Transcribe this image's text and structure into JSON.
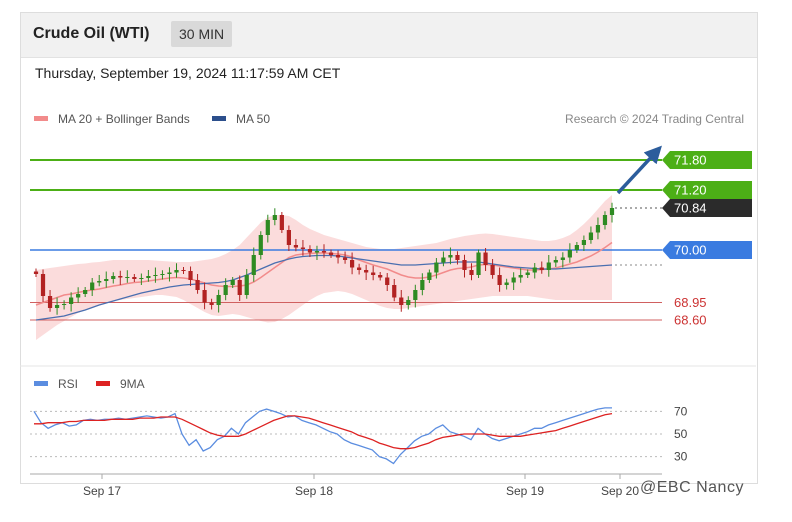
{
  "header": {
    "title": "Crude Oil (WTI)",
    "interval": "30 MIN"
  },
  "timestamp": "Thursday, September 19, 2024 11:17:59 AM CET",
  "credit": "Research © 2024 Trading Central",
  "watermark": "@EBC Nancy",
  "colors": {
    "bull": "#2e8b22",
    "bear": "#b22222",
    "ma20": "#f28b8b",
    "bands": "#f9c9c9",
    "ma50": "#4a6fb0",
    "resistance": "#4caf16",
    "pivot": "#3a7be0",
    "support": "#d06060",
    "rsi": "#5b8de0",
    "rsi_ma": "#dd2222",
    "arrow": "#2c5d9c"
  },
  "chart_data": [
    {
      "type": "candlestick",
      "title": "Crude Oil (WTI) 30 MIN",
      "legend": [
        "MA 20 + Bollinger Bands",
        "MA 50"
      ],
      "legend_position": "top-left",
      "x_ticks": [
        "Sep 17",
        "Sep 18",
        "Sep 19",
        "Sep 20"
      ],
      "ylim": [
        68.0,
        72.2
      ],
      "levels": [
        {
          "label": "71.80",
          "value": 71.8,
          "kind": "resistance"
        },
        {
          "label": "71.20",
          "value": 71.2,
          "kind": "resistance"
        },
        {
          "label": "70.84",
          "value": 70.84,
          "kind": "last"
        },
        {
          "label": "70.00",
          "value": 70.0,
          "kind": "pivot"
        },
        {
          "label": "68.95",
          "value": 68.95,
          "kind": "support"
        },
        {
          "label": "68.60",
          "value": 68.6,
          "kind": "support"
        }
      ],
      "close": [
        69.52,
        69.08,
        68.84,
        68.9,
        68.92,
        69.05,
        69.12,
        69.2,
        69.35,
        69.38,
        69.42,
        69.48,
        69.45,
        69.46,
        69.42,
        69.44,
        69.48,
        69.5,
        69.52,
        69.55,
        69.6,
        69.58,
        69.4,
        69.2,
        68.95,
        68.9,
        69.1,
        69.3,
        69.4,
        69.1,
        69.5,
        69.9,
        70.3,
        70.6,
        70.7,
        70.4,
        70.1,
        70.05,
        70.02,
        69.95,
        69.98,
        69.95,
        69.9,
        69.85,
        69.8,
        69.65,
        69.6,
        69.55,
        69.5,
        69.45,
        69.3,
        69.05,
        68.9,
        69.0,
        69.2,
        69.4,
        69.55,
        69.75,
        69.85,
        69.9,
        69.8,
        69.6,
        69.5,
        69.95,
        69.7,
        69.5,
        69.3,
        69.35,
        69.45,
        69.5,
        69.55,
        69.65,
        69.6,
        69.75,
        69.8,
        69.85,
        70.0,
        70.1,
        70.2,
        70.35,
        70.5,
        70.7,
        70.84
      ],
      "ma20": [
        68.9,
        68.95,
        69.0,
        69.05,
        69.1,
        69.12,
        69.15,
        69.18,
        69.2,
        69.22,
        69.25,
        69.28,
        69.3,
        69.33,
        69.35,
        69.36,
        69.38,
        69.4,
        69.42,
        69.44,
        69.45,
        69.44,
        69.42,
        69.38,
        69.34,
        69.3,
        69.28,
        69.27,
        69.27,
        69.28,
        69.3,
        69.36,
        69.45,
        69.55,
        69.65,
        69.75,
        69.85,
        69.9,
        69.92,
        69.93,
        69.94,
        69.94,
        69.93,
        69.92,
        69.9,
        69.86,
        69.8,
        69.75,
        69.7,
        69.66,
        69.62,
        69.56,
        69.5,
        69.46,
        69.44,
        69.44,
        69.46,
        69.5,
        69.55,
        69.6,
        69.63,
        69.64,
        69.66,
        69.7,
        69.71,
        69.7,
        69.68,
        69.66,
        69.64,
        69.62,
        69.6,
        69.6,
        69.61,
        69.62,
        69.64,
        69.68,
        69.72,
        69.76,
        69.82,
        69.88,
        69.96,
        70.05,
        70.15
      ],
      "bb_upper": [
        69.6,
        69.62,
        69.64,
        69.66,
        69.68,
        69.7,
        69.72,
        69.73,
        69.75,
        69.76,
        69.78,
        69.8,
        69.8,
        69.8,
        69.8,
        69.8,
        69.8,
        69.79,
        69.78,
        69.77,
        69.76,
        69.76,
        69.76,
        69.78,
        69.8,
        69.82,
        69.86,
        69.92,
        70.0,
        70.1,
        70.25,
        70.4,
        70.55,
        70.65,
        70.7,
        70.7,
        70.68,
        70.6,
        70.5,
        70.42,
        70.36,
        70.3,
        70.26,
        70.22,
        70.18,
        70.14,
        70.1,
        70.06,
        70.04,
        70.02,
        70.02,
        70.02,
        70.04,
        70.06,
        70.08,
        70.1,
        70.12,
        70.14,
        70.18,
        70.22,
        70.25,
        70.28,
        70.3,
        70.32,
        70.33,
        70.32,
        70.3,
        70.28,
        70.26,
        70.24,
        70.22,
        70.2,
        70.18,
        70.18,
        70.2,
        70.24,
        70.3,
        70.4,
        70.52,
        70.66,
        70.82,
        70.98,
        71.1
      ],
      "bb_lower": [
        68.2,
        68.3,
        68.4,
        68.5,
        68.58,
        68.66,
        68.74,
        68.8,
        68.86,
        68.9,
        68.94,
        68.98,
        69.0,
        69.02,
        69.04,
        69.06,
        69.08,
        69.1,
        69.1,
        69.08,
        69.06,
        69.0,
        68.92,
        68.84,
        68.76,
        68.7,
        68.68,
        68.7,
        68.72,
        68.7,
        68.66,
        68.62,
        68.58,
        68.55,
        68.56,
        68.62,
        68.7,
        68.8,
        68.9,
        69.0,
        69.08,
        69.14,
        69.16,
        69.18,
        69.16,
        69.12,
        69.06,
        69.0,
        68.94,
        68.88,
        68.84,
        68.82,
        68.82,
        68.84,
        68.86,
        68.88,
        68.9,
        68.92,
        68.94,
        68.96,
        68.98,
        69.0,
        69.02,
        69.04,
        69.06,
        69.08,
        69.08,
        69.08,
        69.08,
        69.08,
        69.08,
        69.06,
        69.04,
        69.02,
        69.0,
        69.0,
        69.0,
        69.0,
        69.0,
        69.0,
        69.0,
        69.0,
        69.0
      ],
      "ma50": [
        68.6,
        68.62,
        68.64,
        68.66,
        68.68,
        68.72,
        68.76,
        68.8,
        68.85,
        68.9,
        68.94,
        68.98,
        69.02,
        69.06,
        69.1,
        69.14,
        69.17,
        69.2,
        69.23,
        69.26,
        69.28,
        69.3,
        69.31,
        69.32,
        69.33,
        69.34,
        69.35,
        69.37,
        69.4,
        69.45,
        69.5,
        69.56,
        69.62,
        69.68,
        69.74,
        69.78,
        69.82,
        69.85,
        69.87,
        69.88,
        69.89,
        69.89,
        69.89,
        69.88,
        69.86,
        69.84,
        69.82,
        69.8,
        69.78,
        69.76,
        69.74,
        69.72,
        69.7,
        69.7,
        69.7,
        69.71,
        69.72,
        69.73,
        69.74,
        69.75,
        69.76,
        69.76,
        69.76,
        69.76,
        69.74,
        69.72,
        69.7,
        69.68,
        69.66,
        69.65,
        69.64,
        69.63,
        69.62,
        69.62,
        69.62,
        69.63,
        69.64,
        69.65,
        69.66,
        69.67,
        69.68,
        69.69,
        69.7
      ]
    },
    {
      "type": "line",
      "title": "",
      "legend": [
        "RSI",
        "9MA"
      ],
      "legend_position": "top-left",
      "ylim": [
        20,
        80
      ],
      "y_ticks": [
        "70",
        "50",
        "30"
      ],
      "series": [
        {
          "name": "RSI",
          "values": [
            70,
            60,
            55,
            58,
            60,
            57,
            58,
            62,
            63,
            62,
            63,
            63,
            64,
            63,
            64,
            65,
            66,
            65,
            64,
            65,
            68,
            50,
            40,
            45,
            35,
            38,
            45,
            48,
            55,
            50,
            60,
            65,
            70,
            72,
            70,
            68,
            65,
            66,
            62,
            60,
            58,
            55,
            52,
            50,
            45,
            42,
            40,
            38,
            36,
            30,
            28,
            24,
            32,
            38,
            44,
            48,
            50,
            55,
            58,
            52,
            50,
            48,
            45,
            55,
            50,
            46,
            44,
            46,
            48,
            50,
            52,
            55,
            55,
            58,
            60,
            62,
            64,
            66,
            68,
            70,
            72,
            73,
            73
          ]
        },
        {
          "name": "9MA",
          "values": [
            59,
            59,
            60,
            60,
            60,
            61,
            61,
            62,
            62,
            62,
            62,
            63,
            63,
            63,
            63,
            64,
            64,
            64,
            65,
            65,
            65,
            63,
            60,
            57,
            54,
            51,
            49,
            48,
            48,
            48,
            50,
            53,
            56,
            59,
            62,
            64,
            66,
            66,
            65,
            64,
            62,
            60,
            58,
            56,
            54,
            52,
            49,
            47,
            45,
            42,
            40,
            38,
            37,
            37,
            38,
            40,
            42,
            45,
            47,
            48,
            49,
            50,
            50,
            50,
            50,
            49,
            48,
            48,
            48,
            48,
            49,
            50,
            51,
            52,
            53,
            55,
            57,
            59,
            61,
            63,
            65,
            67,
            68
          ]
        }
      ]
    }
  ]
}
